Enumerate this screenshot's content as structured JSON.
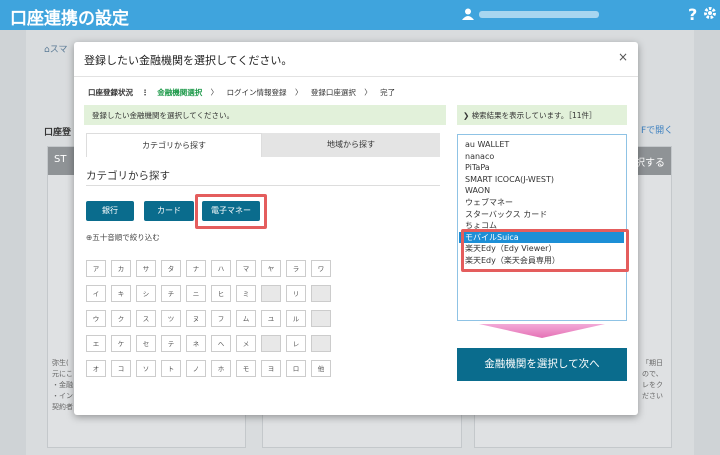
{
  "header": {
    "title": "口座連携の設定",
    "help": "?"
  },
  "background": {
    "breadcrumb": "スマ",
    "section_title": "口座登",
    "link": "Fで開く",
    "col1_head": "ST",
    "col3_head": "択する",
    "text_left": [
      "弥生(",
      "元にこ",
      "・金融",
      "・イン",
      "契約者"
    ],
    "text_right": [
      "「期日",
      "ので、",
      "レをク",
      "ださい"
    ]
  },
  "modal": {
    "title": "登録したい金融機関を選択してください。",
    "close": "×",
    "steps": {
      "label": "口座登録状況",
      "dots": "⋮",
      "items": [
        "金融機関選択",
        "ログイン情報登録",
        "登録口座選択",
        "完了"
      ],
      "arrow": "〉"
    },
    "info": "登録したい金融機関を選択してください。",
    "tabs": [
      "カテゴリから探す",
      "地域から探す"
    ],
    "category_title": "カテゴリから探す",
    "category_buttons": [
      "銀行",
      "カード",
      "電子マネー"
    ],
    "aiueo": "⊕五十音順で絞り込む",
    "kana_rows": [
      [
        "ア",
        "カ",
        "サ",
        "タ",
        "ナ",
        "ハ",
        "マ",
        "ヤ",
        "ラ",
        "ワ"
      ],
      [
        "イ",
        "キ",
        "シ",
        "チ",
        "ニ",
        "ヒ",
        "ミ",
        "",
        "リ",
        ""
      ],
      [
        "ウ",
        "ク",
        "ス",
        "ツ",
        "ヌ",
        "フ",
        "ム",
        "ユ",
        "ル",
        ""
      ],
      [
        "エ",
        "ケ",
        "セ",
        "テ",
        "ネ",
        "ヘ",
        "メ",
        "",
        "レ",
        ""
      ],
      [
        "オ",
        "コ",
        "ソ",
        "ト",
        "ノ",
        "ホ",
        "モ",
        "ヨ",
        "ロ",
        "他"
      ]
    ],
    "results": {
      "header": "❯ 検索結果を表示しています。［11件］",
      "items": [
        "au WALLET",
        "nanaco",
        "PiTaPa",
        "SMART ICOCA(J-WEST)",
        "WAON",
        "ウェブマネー",
        "スターバックス カード",
        "ちょコム",
        "モバイルSuica",
        "楽天Edy（Edy Viewer）",
        "楽天Edy（楽天会員専用）"
      ],
      "selected_index": 8
    },
    "next_button": "金融機関を選択して次へ"
  },
  "colors": {
    "accent": "#0a6c8d",
    "highlight": "#e45d5d",
    "selected": "#1d8fd6",
    "step_active": "#1f9a4b"
  }
}
